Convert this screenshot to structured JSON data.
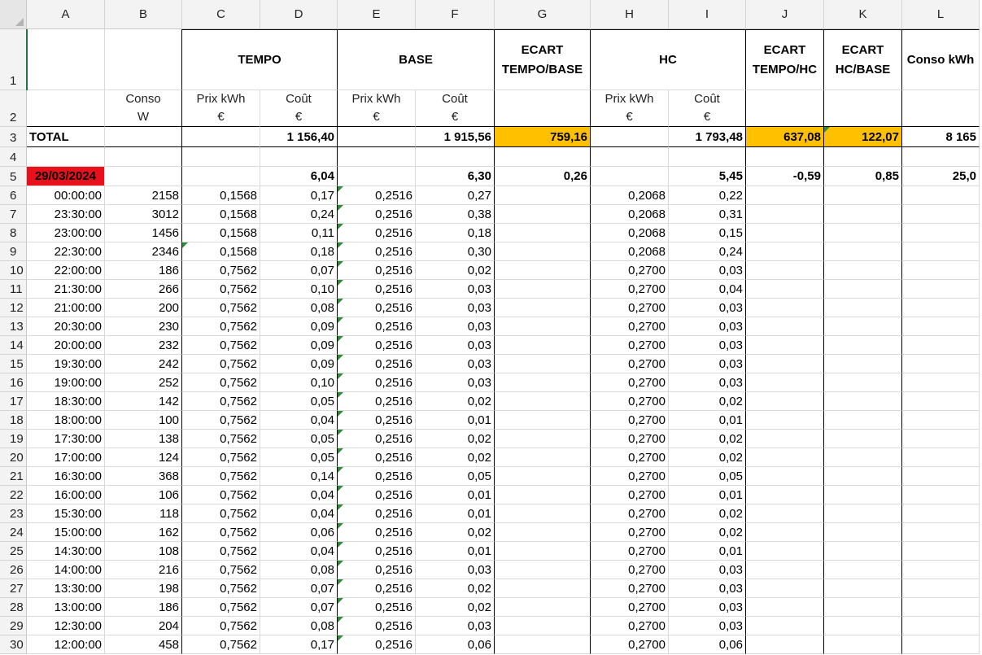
{
  "columns": [
    "A",
    "B",
    "C",
    "D",
    "E",
    "F",
    "G",
    "H",
    "I",
    "J",
    "K",
    "L"
  ],
  "rows_numbers": [
    "1",
    "2",
    "3",
    "4",
    "5",
    "6",
    "7",
    "8",
    "9",
    "10",
    "11",
    "12",
    "13",
    "14",
    "15",
    "16",
    "17",
    "18",
    "19",
    "20",
    "21",
    "22",
    "23",
    "24",
    "25",
    "26",
    "27",
    "28",
    "29",
    "30"
  ],
  "header1": {
    "tempo": "TEMPO",
    "base": "BASE",
    "ecart_tb_l1": "ECART",
    "ecart_tb_l2": "TEMPO/BASE",
    "hc": "HC",
    "ecart_th_l1": "ECART",
    "ecart_th_l2": "TEMPO/HC",
    "ecart_hb_l1": "ECART",
    "ecart_hb_l2": "HC/BASE",
    "conso_kwh": "Conso kWh"
  },
  "header2": {
    "conso_l1": "Conso",
    "conso_l2": "W",
    "tempo_prix_l1": "Prix kWh",
    "tempo_prix_l2": "€",
    "tempo_cout_l1": "Coût",
    "tempo_cout_l2": "€",
    "base_prix_l1": "Prix kWh",
    "base_prix_l2": "€",
    "base_cout_l1": "Coût",
    "base_cout_l2": "€",
    "hc_prix_l1": "Prix kWh",
    "hc_prix_l2": "€",
    "hc_cout_l1": "Coût",
    "hc_cout_l2": "€"
  },
  "total": {
    "label": "TOTAL",
    "tempo_cout": "1 156,40",
    "base_cout": "1 915,56",
    "ecart_tb": "759,16",
    "hc_cout": "1 793,48",
    "ecart_th": "637,08",
    "ecart_hb": "122,07",
    "conso_kwh": "8 165"
  },
  "day": {
    "date": "29/03/2024",
    "tempo_cout": "6,04",
    "base_cout": "6,30",
    "ecart_tb": "0,26",
    "hc_cout": "5,45",
    "ecart_th": "-0,59",
    "ecart_hb": "0,85",
    "conso_kwh": "25,0"
  },
  "data_rows": [
    {
      "time": "00:00:00",
      "conso": "2158",
      "tprix": "0,1568",
      "tcout": "0,17",
      "bprix": "0,2516",
      "bcout": "0,27",
      "hprix": "0,2068",
      "hcout": "0,22"
    },
    {
      "time": "23:30:00",
      "conso": "3012",
      "tprix": "0,1568",
      "tcout": "0,24",
      "bprix": "0,2516",
      "bcout": "0,38",
      "hprix": "0,2068",
      "hcout": "0,31"
    },
    {
      "time": "23:00:00",
      "conso": "1456",
      "tprix": "0,1568",
      "tcout": "0,11",
      "bprix": "0,2516",
      "bcout": "0,18",
      "hprix": "0,2068",
      "hcout": "0,15"
    },
    {
      "time": "22:30:00",
      "conso": "2346",
      "tprix": "0,1568",
      "tcout": "0,18",
      "bprix": "0,2516",
      "bcout": "0,30",
      "hprix": "0,2068",
      "hcout": "0,24"
    },
    {
      "time": "22:00:00",
      "conso": "186",
      "tprix": "0,7562",
      "tcout": "0,07",
      "bprix": "0,2516",
      "bcout": "0,02",
      "hprix": "0,2700",
      "hcout": "0,03"
    },
    {
      "time": "21:30:00",
      "conso": "266",
      "tprix": "0,7562",
      "tcout": "0,10",
      "bprix": "0,2516",
      "bcout": "0,03",
      "hprix": "0,2700",
      "hcout": "0,04"
    },
    {
      "time": "21:00:00",
      "conso": "200",
      "tprix": "0,7562",
      "tcout": "0,08",
      "bprix": "0,2516",
      "bcout": "0,03",
      "hprix": "0,2700",
      "hcout": "0,03"
    },
    {
      "time": "20:30:00",
      "conso": "230",
      "tprix": "0,7562",
      "tcout": "0,09",
      "bprix": "0,2516",
      "bcout": "0,03",
      "hprix": "0,2700",
      "hcout": "0,03"
    },
    {
      "time": "20:00:00",
      "conso": "232",
      "tprix": "0,7562",
      "tcout": "0,09",
      "bprix": "0,2516",
      "bcout": "0,03",
      "hprix": "0,2700",
      "hcout": "0,03"
    },
    {
      "time": "19:30:00",
      "conso": "242",
      "tprix": "0,7562",
      "tcout": "0,09",
      "bprix": "0,2516",
      "bcout": "0,03",
      "hprix": "0,2700",
      "hcout": "0,03"
    },
    {
      "time": "19:00:00",
      "conso": "252",
      "tprix": "0,7562",
      "tcout": "0,10",
      "bprix": "0,2516",
      "bcout": "0,03",
      "hprix": "0,2700",
      "hcout": "0,03"
    },
    {
      "time": "18:30:00",
      "conso": "142",
      "tprix": "0,7562",
      "tcout": "0,05",
      "bprix": "0,2516",
      "bcout": "0,02",
      "hprix": "0,2700",
      "hcout": "0,02"
    },
    {
      "time": "18:00:00",
      "conso": "100",
      "tprix": "0,7562",
      "tcout": "0,04",
      "bprix": "0,2516",
      "bcout": "0,01",
      "hprix": "0,2700",
      "hcout": "0,01"
    },
    {
      "time": "17:30:00",
      "conso": "138",
      "tprix": "0,7562",
      "tcout": "0,05",
      "bprix": "0,2516",
      "bcout": "0,02",
      "hprix": "0,2700",
      "hcout": "0,02"
    },
    {
      "time": "17:00:00",
      "conso": "124",
      "tprix": "0,7562",
      "tcout": "0,05",
      "bprix": "0,2516",
      "bcout": "0,02",
      "hprix": "0,2700",
      "hcout": "0,02"
    },
    {
      "time": "16:30:00",
      "conso": "368",
      "tprix": "0,7562",
      "tcout": "0,14",
      "bprix": "0,2516",
      "bcout": "0,05",
      "hprix": "0,2700",
      "hcout": "0,05"
    },
    {
      "time": "16:00:00",
      "conso": "106",
      "tprix": "0,7562",
      "tcout": "0,04",
      "bprix": "0,2516",
      "bcout": "0,01",
      "hprix": "0,2700",
      "hcout": "0,01"
    },
    {
      "time": "15:30:00",
      "conso": "118",
      "tprix": "0,7562",
      "tcout": "0,04",
      "bprix": "0,2516",
      "bcout": "0,01",
      "hprix": "0,2700",
      "hcout": "0,02"
    },
    {
      "time": "15:00:00",
      "conso": "162",
      "tprix": "0,7562",
      "tcout": "0,06",
      "bprix": "0,2516",
      "bcout": "0,02",
      "hprix": "0,2700",
      "hcout": "0,02"
    },
    {
      "time": "14:30:00",
      "conso": "108",
      "tprix": "0,7562",
      "tcout": "0,04",
      "bprix": "0,2516",
      "bcout": "0,01",
      "hprix": "0,2700",
      "hcout": "0,01"
    },
    {
      "time": "14:00:00",
      "conso": "216",
      "tprix": "0,7562",
      "tcout": "0,08",
      "bprix": "0,2516",
      "bcout": "0,03",
      "hprix": "0,2700",
      "hcout": "0,03"
    },
    {
      "time": "13:30:00",
      "conso": "198",
      "tprix": "0,7562",
      "tcout": "0,07",
      "bprix": "0,2516",
      "bcout": "0,02",
      "hprix": "0,2700",
      "hcout": "0,03"
    },
    {
      "time": "13:00:00",
      "conso": "186",
      "tprix": "0,7562",
      "tcout": "0,07",
      "bprix": "0,2516",
      "bcout": "0,02",
      "hprix": "0,2700",
      "hcout": "0,03"
    },
    {
      "time": "12:30:00",
      "conso": "204",
      "tprix": "0,7562",
      "tcout": "0,08",
      "bprix": "0,2516",
      "bcout": "0,03",
      "hprix": "0,2700",
      "hcout": "0,03"
    },
    {
      "time": "12:00:00",
      "conso": "458",
      "tprix": "0,7562",
      "tcout": "0,17",
      "bprix": "0,2516",
      "bcout": "0,06",
      "hprix": "0,2700",
      "hcout": "0,06"
    }
  ],
  "colors": {
    "highlight_orange": "#ffc000",
    "date_red": "#e8101a",
    "flag_green": "#2e8b3a"
  }
}
